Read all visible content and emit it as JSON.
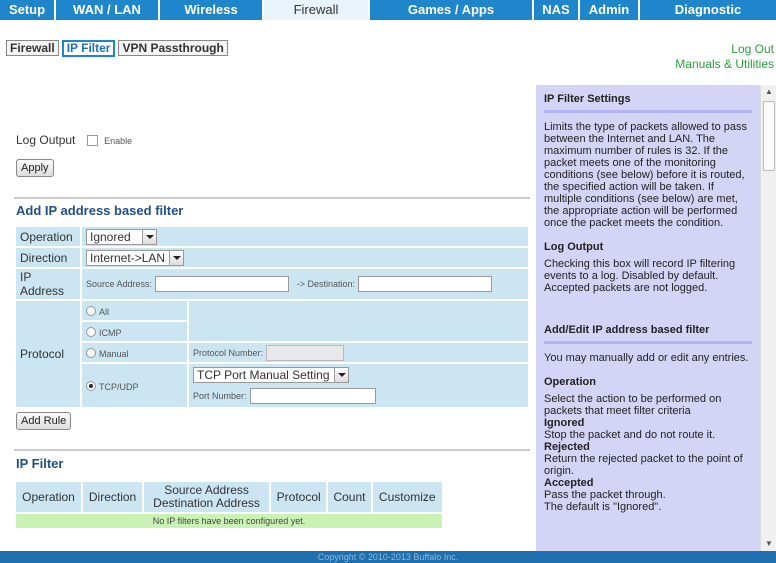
{
  "nav": {
    "tabs": [
      {
        "label": "Setup",
        "active": false
      },
      {
        "label": "WAN / LAN",
        "active": false
      },
      {
        "label": "Wireless",
        "active": false
      },
      {
        "label": "Firewall",
        "active": true
      },
      {
        "label": "Games / Apps",
        "active": false
      },
      {
        "label": "NAS",
        "active": false
      },
      {
        "label": "Admin",
        "active": false
      },
      {
        "label": "Diagnostic",
        "active": false
      }
    ]
  },
  "subnav": {
    "tabs": [
      {
        "label": "Firewall",
        "active": false
      },
      {
        "label": "IP Filter",
        "active": true
      },
      {
        "label": "VPN Passthrough",
        "active": false
      }
    ],
    "logout": "Log Out",
    "manuals": "Manuals & Utilities"
  },
  "log_output": {
    "label": "Log Output",
    "checkbox_label": "Enable",
    "checked": false,
    "apply": "Apply"
  },
  "add_filter": {
    "title": "Add IP address based filter",
    "operation_label": "Operation",
    "operation_value": "Ignored",
    "direction_label": "Direction",
    "direction_value": "Internet->LAN",
    "ip_label": "IP Address",
    "source_label": "Source Address:",
    "source_value": "",
    "dest_label": "-> Destination:",
    "dest_value": "",
    "protocol_label": "Protocol",
    "protocols": [
      "All",
      "ICMP",
      "Manual",
      "TCP/UDP"
    ],
    "selected_protocol": "TCP/UDP",
    "protocol_number_label": "Protocol Number:",
    "tcp_select_value": "TCP Port Manual Setting",
    "port_number_label": "Port Number:",
    "add_rule": "Add Rule"
  },
  "ip_filter_list": {
    "title": "IP Filter",
    "headers": [
      "Operation",
      "Direction",
      "Source Address",
      "Destination Address",
      "Protocol",
      "Count",
      "Customize"
    ],
    "empty_message": "No IP filters have been configured yet."
  },
  "help": {
    "title": "IP Filter Settings",
    "intro": "Limits the type of packets allowed to pass between the Internet and LAN. The maximum number of rules is 32. If the packet meets one of the monitoring conditions (see below) before it is routed, the specified action will be taken. If multiple conditions (see below) are met, the appropriate action will be performed once the packet meets the condition.",
    "log_title": "Log Output",
    "log_text": "Checking this box will record IP filtering events to a log. Disabled by default. Accepted packets are not logged.",
    "add_title": "Add/Edit IP address based filter",
    "add_text": "You may manually add or edit any entries.",
    "operation_title": "Operation",
    "operation_text": "Select the action to be performed on packets that meet filter criteria",
    "ignored_title": "Ignored",
    "ignored_text": "Stop the packet and do not route it.",
    "rejected_title": "Rejected",
    "rejected_text": "Return the rejected packet to the point of origin.",
    "accepted_title": "Accepted",
    "accepted_text": "Pass the packet through.",
    "default_text": "The default is \"Ignored\"."
  },
  "footer": {
    "copyright": "Copyright © 2010-2013 Buffalo Inc."
  }
}
